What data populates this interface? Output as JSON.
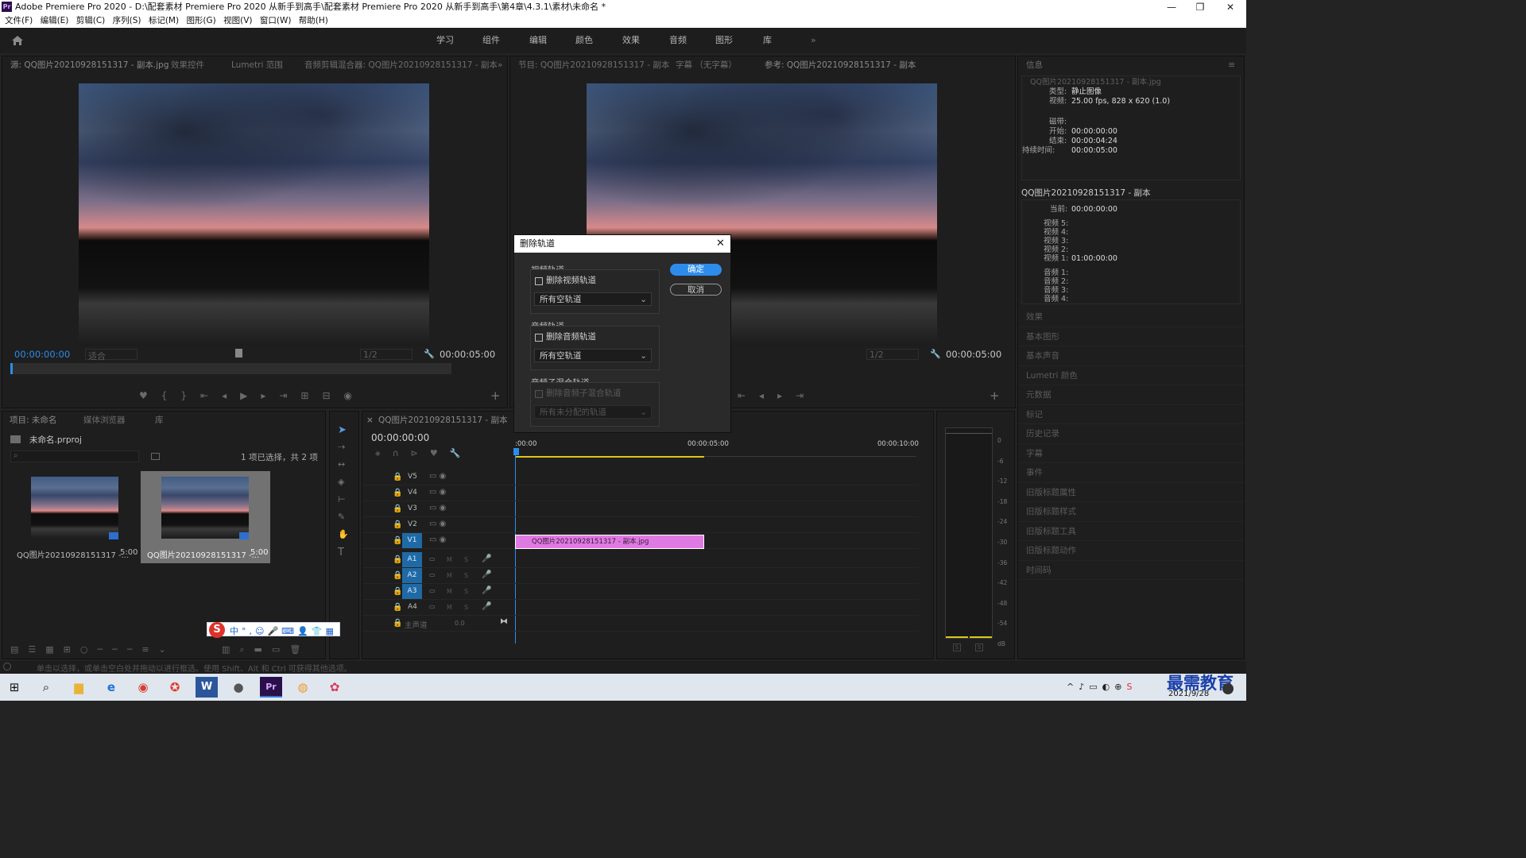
{
  "window": {
    "app_badge": "Pr",
    "title": "Adobe Premiere Pro 2020 - D:\\配套素材 Premiere Pro 2020 从新手到高手\\配套素材 Premiere Pro 2020 从新手到高手\\第4章\\4.3.1\\素材\\未命名 *",
    "minimize": "—",
    "restore": "❐",
    "close": "✕"
  },
  "menu": [
    "文件(F)",
    "编辑(E)",
    "剪辑(C)",
    "序列(S)",
    "标记(M)",
    "图形(G)",
    "视图(V)",
    "窗口(W)",
    "帮助(H)"
  ],
  "workspaces": [
    "学习",
    "组件",
    "编辑",
    "颜色",
    "效果",
    "音频",
    "图形",
    "库"
  ],
  "workspaces_more": "»",
  "source_panel": {
    "tabs": [
      "源: QQ图片20210928151317 - 副本.jpg",
      "效果控件",
      "Lumetri 范围",
      "音频剪辑混合器: QQ图片20210928151317 - 副本"
    ],
    "more": "»",
    "timecode_left": "00:00:00:00",
    "fit": "适合",
    "ratio": "1/2",
    "timecode_right": "00:00:05:00"
  },
  "program_panel": {
    "tabs": [
      "节目: QQ图片20210928151317 - 副本",
      "字幕 （无字幕）",
      "参考: QQ图片20210928151317 - 副本"
    ],
    "ratio": "1/2",
    "timecode_right": "00:00:05:00"
  },
  "info_panel": {
    "tab": "信息",
    "clip_name": "QQ图片20210928151317 - 副本.jpg",
    "type_label": "类型:",
    "type_value": "静止图像",
    "video_label": "视频:",
    "video_value": "25.00 fps, 828 x 620 (1.0)",
    "tape_label": "磁带:",
    "start_label": "开始:",
    "start_value": "00:00:00:00",
    "end_label": "结束:",
    "end_value": "00:00:04:24",
    "duration_label": "持续时间:",
    "duration_value": "00:00:05:00",
    "seq_name": "QQ图片20210928151317 - 副本",
    "current_label": "当前:",
    "current_value": "00:00:00:00",
    "video_tracks": [
      "视频 5:",
      "视频 4:",
      "视频 3:",
      "视频 2:",
      "视频 1:"
    ],
    "video1_value": "01:00:00:00",
    "audio_tracks": [
      "音频 1:",
      "音频 2:",
      "音频 3:",
      "音频 4:"
    ]
  },
  "right_panels": [
    "效果",
    "基本图形",
    "基本声音",
    "Lumetri 颜色",
    "元数据",
    "标记",
    "历史记录",
    "字幕",
    "事件",
    "旧版标题属性",
    "旧版标题样式",
    "旧版标题工具",
    "旧版标题动作",
    "时间码"
  ],
  "project_panel": {
    "tabs": [
      "项目: 未命名",
      "媒体浏览器",
      "库"
    ],
    "project_file": "未命名.prproj",
    "selection_status": "1 项已选择，共 2 项",
    "items": [
      {
        "name": "QQ图片20210928151317 -...",
        "duration": "5:00"
      },
      {
        "name": "QQ图片20210928151317 -...",
        "duration": "5:00"
      }
    ]
  },
  "timeline": {
    "close": "×",
    "tab": "QQ图片20210928151317 - 副本",
    "timecode": "00:00:00:00",
    "ruler": [
      ":00:00",
      "00:00:05:00",
      "00:00:10:00"
    ],
    "video_tracks": [
      "V5",
      "V4",
      "V3",
      "V2",
      "V1"
    ],
    "audio_tracks": [
      "A1",
      "A2",
      "A3",
      "A4"
    ],
    "master_label": "主声道",
    "master_value": "0.0",
    "clip_label": "QQ图片20210928151317 - 副本.jpg",
    "m": "M",
    "s": "S"
  },
  "meter": {
    "scale": [
      "0",
      "-6",
      "-12",
      "-18",
      "-24",
      "-30",
      "-36",
      "-42",
      "-48",
      "-54",
      "dB"
    ],
    "solo": [
      "S",
      "S"
    ]
  },
  "status_bar": "单击以选择，或单击空白处并拖动以进行框选。使用 Shift、Alt 和 Ctrl 可获得其他选项。",
  "dialog": {
    "title": "删除轨道",
    "close": "✕",
    "video_group": "视频轨道",
    "video_checkbox": "删除视频轨道",
    "video_select": "所有空轨道",
    "audio_group": "音频轨道",
    "audio_checkbox": "删除音频轨道",
    "audio_select": "所有空轨道",
    "submix_group": "音频子混合轨道",
    "submix_checkbox": "删除音频子混合轨道",
    "submix_select": "所有未分配的轨道",
    "ok": "确定",
    "cancel": "取消"
  },
  "ime_bar": [
    "中",
    "°,",
    "☺",
    "🎤",
    "⌨",
    "👤",
    "👕",
    "▦"
  ],
  "taskbar": {
    "watermark": "最需教育",
    "date": "2021/9/28"
  },
  "colors": {
    "accent_blue": "#2d8ceb",
    "clip_pink": "#e07ae3",
    "track_blue": "#1f6aa5",
    "yellow_work_area": "#d7c81a"
  }
}
